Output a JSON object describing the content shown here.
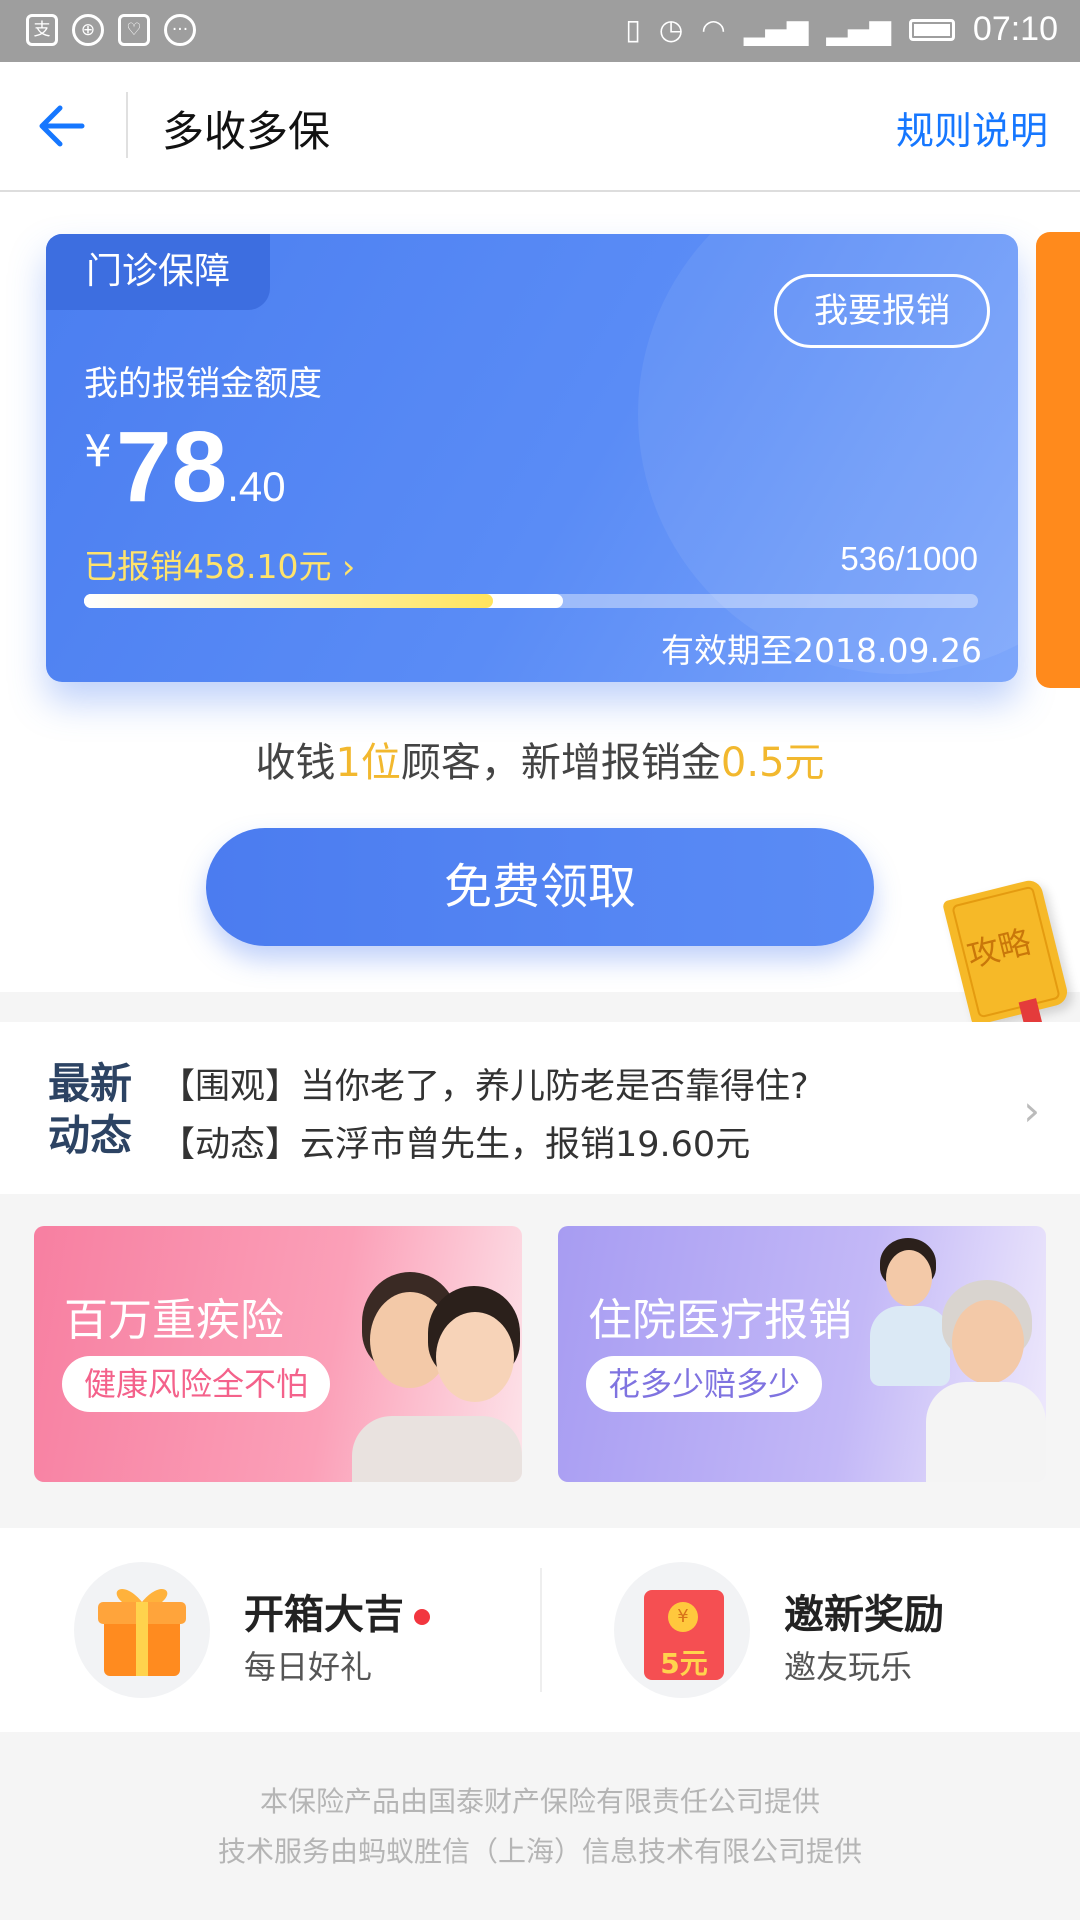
{
  "status_bar": {
    "left_icons": [
      "支",
      "⊕",
      "♡",
      "···"
    ],
    "time": "07:10"
  },
  "header": {
    "title": "多收多保",
    "rules_link": "规则说明"
  },
  "card": {
    "tag": "门诊保障",
    "reimburse_button": "我要报销",
    "amount_label": "我的报销金额度",
    "currency": "¥",
    "amount_int": "78",
    "amount_dec": ".40",
    "reimbursed_text": "已报销458.10元",
    "reimbursed_chevron": "›",
    "counter": "536/1000",
    "progress_fraction": 0.536,
    "reimbursed_fraction": 0.458,
    "validity": "有效期至2018.09.26"
  },
  "bonus": {
    "prefix": "收钱",
    "customers": "1位",
    "middle": "顾客，新增报销金",
    "amount": "0.5元"
  },
  "claim_button": "免费领取",
  "guide_badge": "攻略",
  "news": {
    "label_line1": "最新",
    "label_line2": "动态",
    "items": [
      "【围观】当你老了，养儿防老是否靠得住?",
      "【动态】云浮市曾先生，报销19.60元"
    ]
  },
  "banners": [
    {
      "title": "百万重疾险",
      "subtitle": "健康风险全不怕"
    },
    {
      "title": "住院医疗报销",
      "subtitle": "花多少赔多少"
    }
  ],
  "features": [
    {
      "title": "开箱大吉",
      "subtitle": "每日好礼"
    },
    {
      "title": "邀新奖励",
      "subtitle": "邀友玩乐",
      "icon_text": "5元",
      "icon_symbol": "¥"
    }
  ],
  "footer": {
    "line1": "本保险产品由国泰财产保险有限责任公司提供",
    "line2": "技术服务由蚂蚁胜信（上海）信息技术有限公司提供"
  },
  "colors": {
    "accent": "#1677ff",
    "card_blue": "#4b7ef0",
    "highlight_yellow": "#f2b82e",
    "side_orange": "#ff8a1c"
  }
}
